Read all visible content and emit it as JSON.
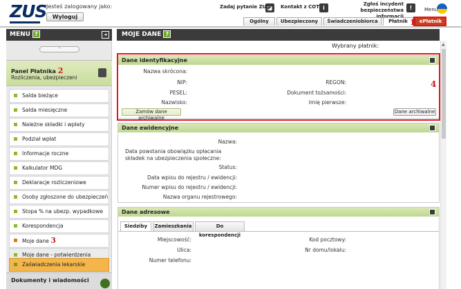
{
  "header": {
    "logo": "ZUS",
    "logged_label": "Jesteś zalogowany jako:",
    "logout": "Wyloguj",
    "links": [
      "Zadaj pytanie ZUS",
      "Kontakt z COT",
      "Zgłoś incydent bezpieczeństwa informacji"
    ],
    "lang": "Menu"
  },
  "tabs": [
    "Ogólny",
    "Ubezpieczony",
    "Świadczeniobiorca",
    "Płatnik",
    "ePłatnik"
  ],
  "menu": {
    "title": "MENU",
    "help": "?",
    "handle": "⌃",
    "panel_title": "Panel Płatnika",
    "panel_subtitle": "Rozliczenia, ubezpieczeni",
    "items": [
      "Salda bieżące",
      "Salda miesięczne",
      "Należne składki i wpłaty",
      "Podział wpłat",
      "Informacje roczne",
      "Kalkulator MDG",
      "Deklaracje rozliczeniowe",
      "Osoby zgłoszone do ubezpieczeń",
      "Stopa % na ubezp. wypadkowe",
      "Korespondencja",
      "Moje dane",
      "Moje dane - potwierdzenia",
      "Zaświadczenia lekarskie"
    ],
    "docs": "Dokumenty i wiadomości"
  },
  "main": {
    "title": "MOJE DANE",
    "help": "?",
    "payer_label": "Wybrany płatnik:",
    "identyfikacyjne": {
      "title": "Dane identyfikacyjne",
      "labels": [
        "Nazwa skrócona:",
        "NIP:",
        "REGON:",
        "PESEL:",
        "Dokument tożsamości:",
        "Nazwisko:",
        "Imię pierwsze:"
      ],
      "btn_order": "Zamów dane archiwalne",
      "btn_archive": "Dane archiwalne"
    },
    "ewidencyjne": {
      "title": "Dane ewidencyjne",
      "labels": [
        "Nazwa:",
        "Data powstania obowiązku opłacania składek na ubezpieczenia społeczne:",
        "Status:",
        "Data wpisu do rejestru / ewidencji:",
        "Numer wpisu do rejestru / ewidencji:",
        "Nazwa organu rejestrowego:"
      ]
    },
    "adresowe": {
      "title": "Dane adresowe",
      "tabs": [
        "Siedziby",
        "Zamieszkania",
        "Do korespondencji"
      ],
      "labels": [
        "Miejscowość:",
        "Kod pocztowy:",
        "Ulica:",
        "Nr domu/lokalu:",
        "Numer telefonu:"
      ]
    }
  },
  "annotations": [
    "1",
    "2",
    "3",
    "4"
  ]
}
